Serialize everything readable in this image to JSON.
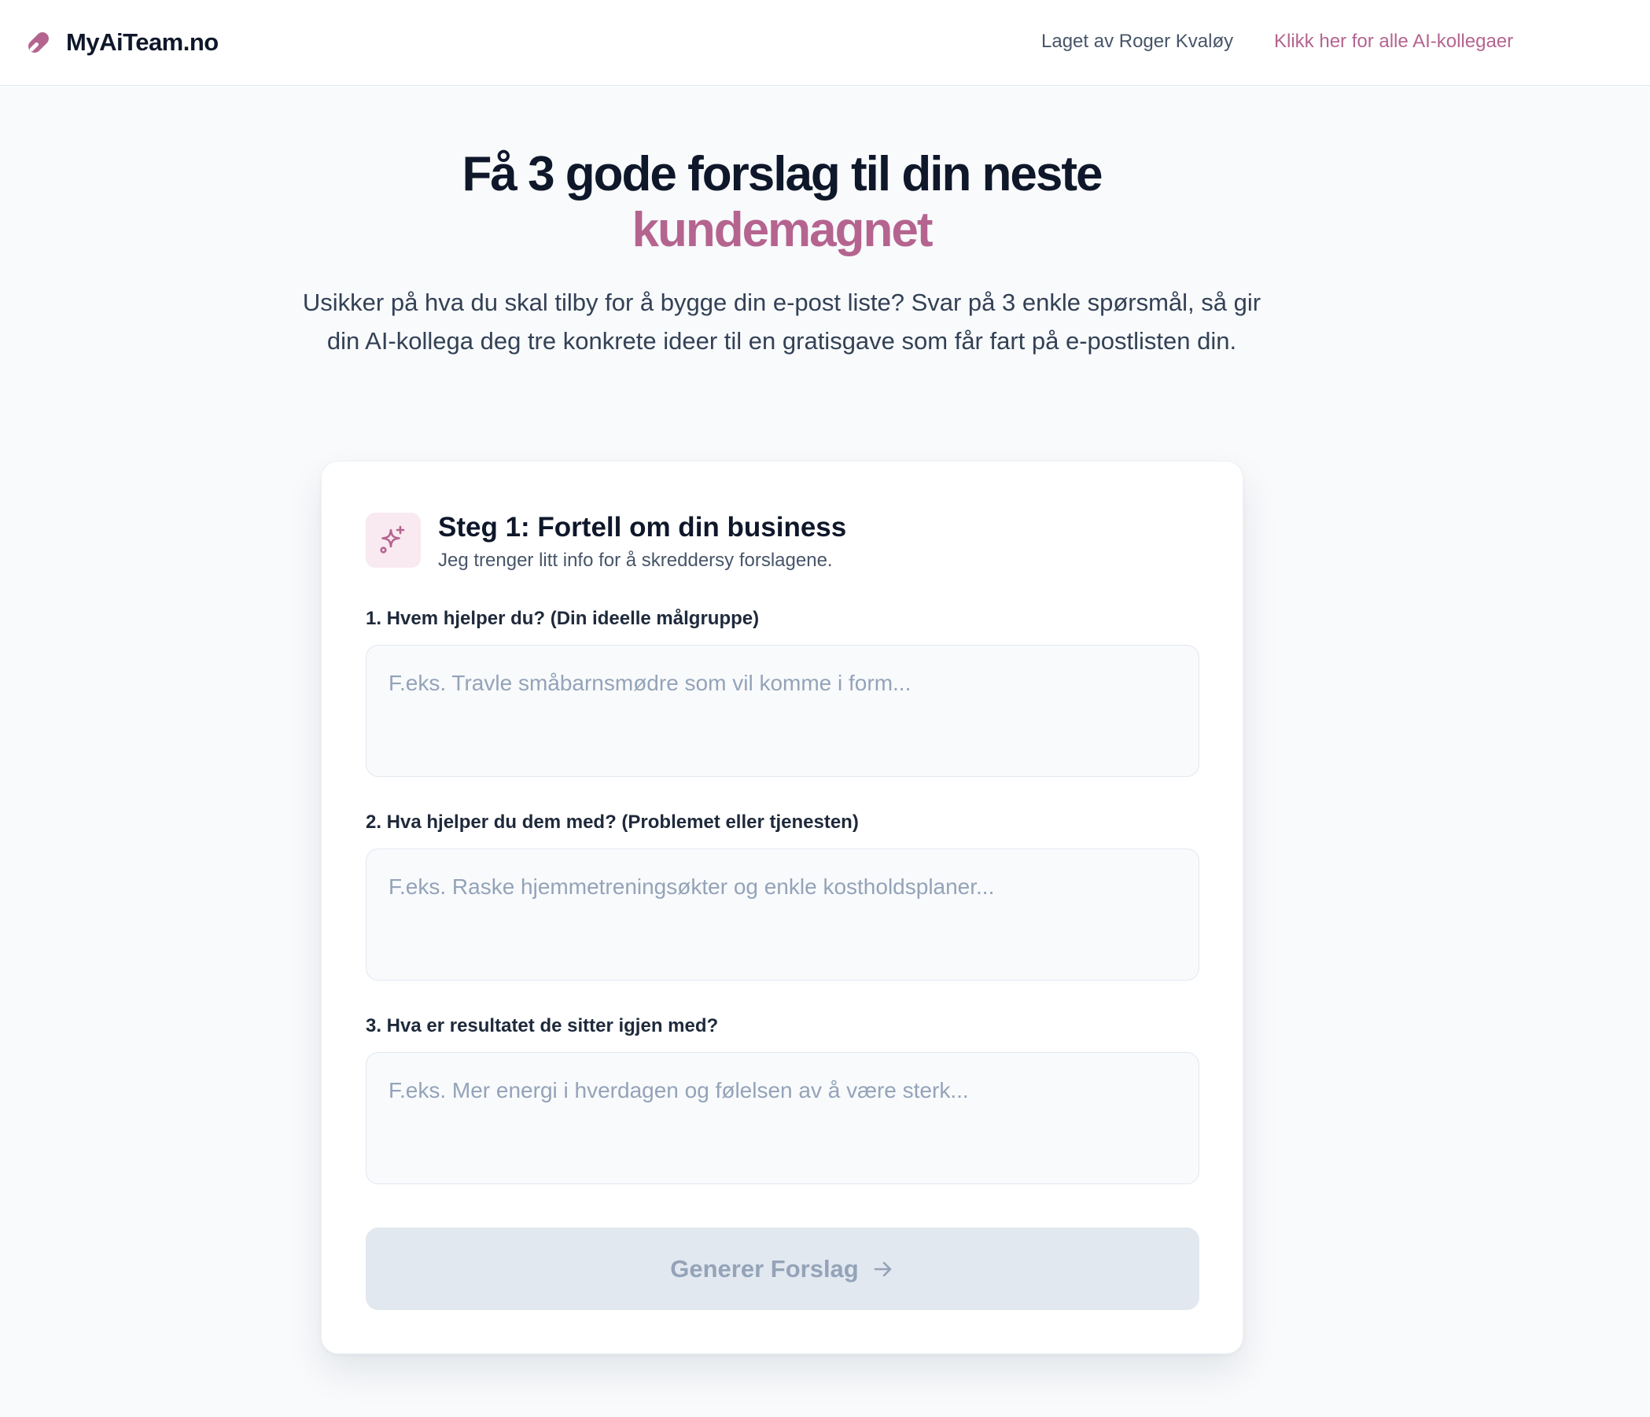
{
  "header": {
    "brand": "MyAiTeam.no",
    "author_link": "Laget av Roger Kvaløy",
    "cta_link": "Klikk her for alle AI-kollegaer"
  },
  "hero": {
    "title": "Få 3 gode forslag til din neste",
    "title_accent": "kundemagnet",
    "subtitle": "Usikker på hva du skal tilby for å bygge din e-post liste? Svar på 3 enkle spørsmål, så gir din AI-kollega deg tre konkrete ideer til en gratisgave som får fart på e-postlisten din."
  },
  "form": {
    "step_icon": "sparkles-icon",
    "step_title": "Steg 1: Fortell om din business",
    "step_subtitle": "Jeg trenger litt info for å skreddersy forslagene.",
    "fields": [
      {
        "label": "1. Hvem hjelper du? (Din ideelle målgruppe)",
        "placeholder": "F.eks. Travle småbarnsmødre som vil komme i form...",
        "value": ""
      },
      {
        "label": "2. Hva hjelper du dem med? (Problemet eller tjenesten)",
        "placeholder": "F.eks. Raske hjemmetreningsøkter og enkle kostholdsplaner...",
        "value": ""
      },
      {
        "label": "3. Hva er resultatet de sitter igjen med?",
        "placeholder": "F.eks. Mer energi i hverdagen og følelsen av å være sterk...",
        "value": ""
      }
    ],
    "submit_label": "Generer Forslag",
    "submit_icon": "arrow-right-icon",
    "submit_disabled": true
  },
  "colors": {
    "accent": "#b5648f",
    "text_dark": "#0f172a",
    "text_muted": "#475569",
    "background": "#f8fafc",
    "button_disabled": "#e2e8f0"
  }
}
